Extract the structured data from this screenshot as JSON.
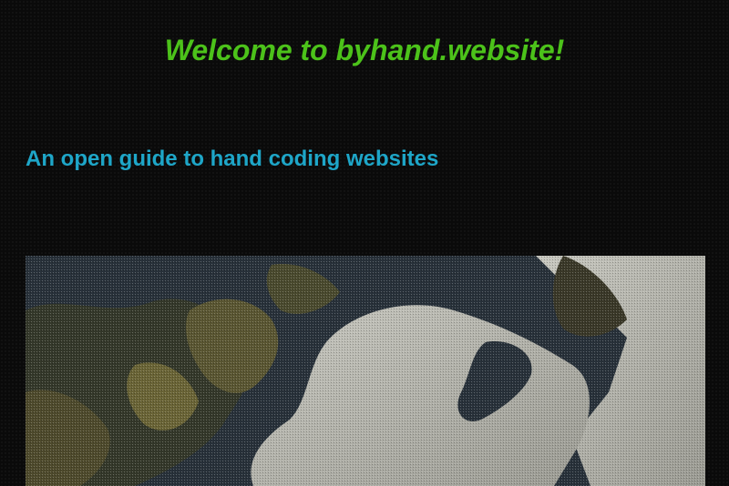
{
  "header": {
    "title": "Welcome to byhand.website!"
  },
  "intro": {
    "subtitle": "An open guide to hand coding websites"
  },
  "hero_image": {
    "subject": "satellite-view-icon"
  },
  "colors": {
    "title": "#4cc21a",
    "subtitle": "#1ea6c8",
    "background": "#0a0a0a",
    "water": "#2a323a",
    "land": "#4a4a2e",
    "ice": "#b8b8b0"
  }
}
